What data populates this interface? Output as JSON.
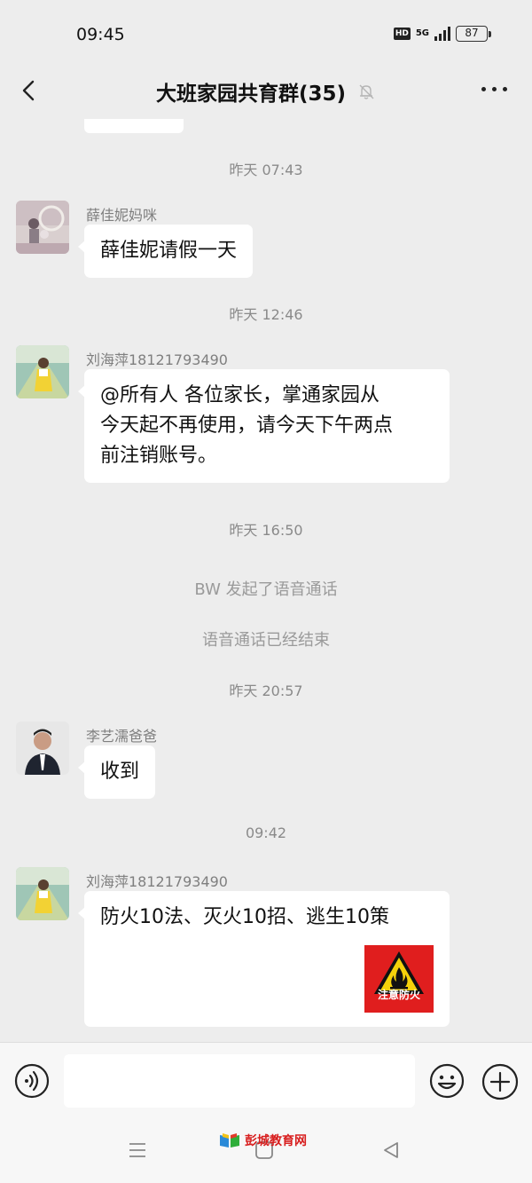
{
  "status_bar": {
    "time": "09:45",
    "hd_badge": "HD",
    "network": "5G",
    "battery": "87"
  },
  "header": {
    "title": "大班家园共育群(35)",
    "back_icon": "chevron-left-icon",
    "mute_icon": "bell-off-icon",
    "more_icon": "more-dots-icon"
  },
  "messages": {
    "ts1": "昨天 07:43",
    "msg1": {
      "sender": "薛佳妮妈咪",
      "text": "薛佳妮请假一天"
    },
    "ts2": "昨天 12:46",
    "msg2": {
      "sender": "刘海萍18121793490",
      "line1": "@所有人  各位家长，掌通家园从",
      "line2": "今天起不再使用，请今天下午两点",
      "line3": "前注销账号。"
    },
    "ts3": "昨天 16:50",
    "sys1": "BW 发起了语音通话",
    "sys2": "语音通话已经结束",
    "ts4": "昨天 20:57",
    "msg3": {
      "sender": "李艺濡爸爸",
      "text": "收到"
    },
    "ts5": "09:42",
    "msg4": {
      "sender": "刘海萍18121793490",
      "text": "防火10法、灭火10招、逃生10策",
      "sign_label": "注意防火"
    }
  },
  "input_bar": {
    "voice_icon": "voice-input-icon",
    "emoji_icon": "emoji-icon",
    "plus_icon": "plus-icon"
  },
  "nav_bar": {
    "watermark": "彭城教育网"
  },
  "colors": {
    "background": "#ededed",
    "bubble": "#ffffff",
    "fire_sign": "#e01e1e"
  }
}
